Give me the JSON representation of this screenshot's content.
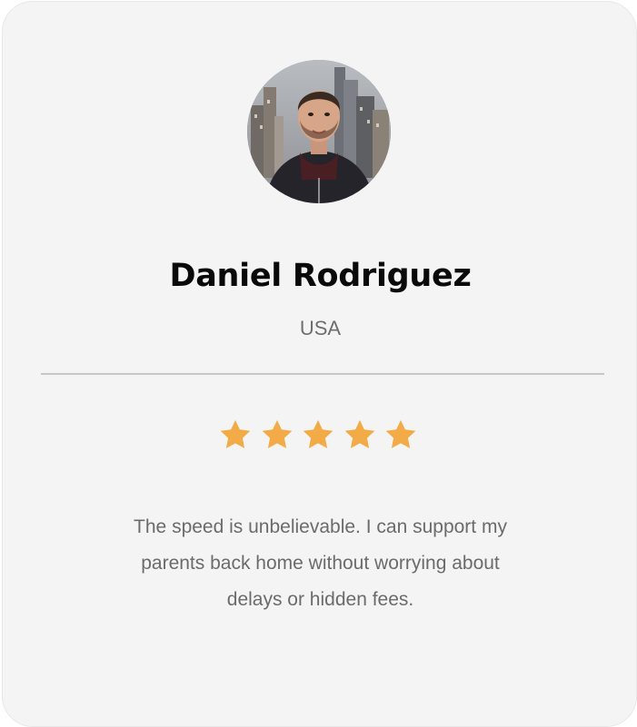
{
  "testimonial": {
    "name": "Daniel Rodriguez",
    "country": "USA",
    "rating": 5,
    "rating_max": 5,
    "quote": "The speed is unbelievable. I can support my parents back home without worrying about delays or hidden fees.",
    "avatar_icon": "user-photo"
  },
  "colors": {
    "card_background": "#f4f4f4",
    "star": "#f2ab46",
    "name": "#0a0a0a",
    "secondary_text": "#6e6e6e",
    "divider": "#c6c6c6"
  }
}
